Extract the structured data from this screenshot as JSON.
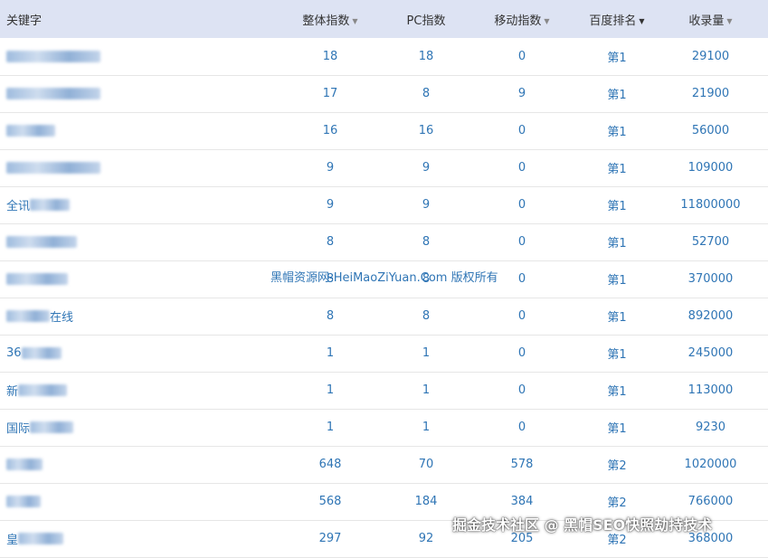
{
  "headers": {
    "keyword": "关键字",
    "overall": "整体指数",
    "pc": "PC指数",
    "mobile": "移动指数",
    "rank": "百度排名",
    "indexed": "收录量"
  },
  "rows": [
    {
      "kw_prefix": "",
      "overall": "18",
      "pc": "18",
      "mobile": "0",
      "rank": "第1",
      "indexed": "29100"
    },
    {
      "kw_prefix": "",
      "overall": "17",
      "pc": "8",
      "mobile": "9",
      "rank": "第1",
      "indexed": "21900"
    },
    {
      "kw_prefix": "",
      "overall": "16",
      "pc": "16",
      "mobile": "0",
      "rank": "第1",
      "indexed": "56000"
    },
    {
      "kw_prefix": "",
      "overall": "9",
      "pc": "9",
      "mobile": "0",
      "rank": "第1",
      "indexed": "109000"
    },
    {
      "kw_prefix": "全讯",
      "overall": "9",
      "pc": "9",
      "mobile": "0",
      "rank": "第1",
      "indexed": "11800000"
    },
    {
      "kw_prefix": "",
      "overall": "8",
      "pc": "8",
      "mobile": "0",
      "rank": "第1",
      "indexed": "52700"
    },
    {
      "kw_prefix": "",
      "overall": "8",
      "pc": "8",
      "mobile": "0",
      "rank": "第1",
      "indexed": "370000"
    },
    {
      "kw_prefix": "在线",
      "overall": "8",
      "pc": "8",
      "mobile": "0",
      "rank": "第1",
      "indexed": "892000"
    },
    {
      "kw_prefix": "36",
      "overall": "1",
      "pc": "1",
      "mobile": "0",
      "rank": "第1",
      "indexed": "245000"
    },
    {
      "kw_prefix": "新",
      "overall": "1",
      "pc": "1",
      "mobile": "0",
      "rank": "第1",
      "indexed": "113000"
    },
    {
      "kw_prefix": "国际",
      "overall": "1",
      "pc": "1",
      "mobile": "0",
      "rank": "第1",
      "indexed": "9230"
    },
    {
      "kw_prefix": "",
      "overall": "648",
      "pc": "70",
      "mobile": "578",
      "rank": "第2",
      "indexed": "1020000"
    },
    {
      "kw_prefix": "",
      "overall": "568",
      "pc": "184",
      "mobile": "384",
      "rank": "第2",
      "indexed": "766000"
    },
    {
      "kw_prefix": "皇",
      "overall": "297",
      "pc": "92",
      "mobile": "205",
      "rank": "第2",
      "indexed": "368000"
    }
  ],
  "watermark": "黑帽资源网-HeiMaoZiYuan.Com 版权所有",
  "footer_watermark": "掘金技术社区 @ 黑帽SEO快照劫持技术"
}
